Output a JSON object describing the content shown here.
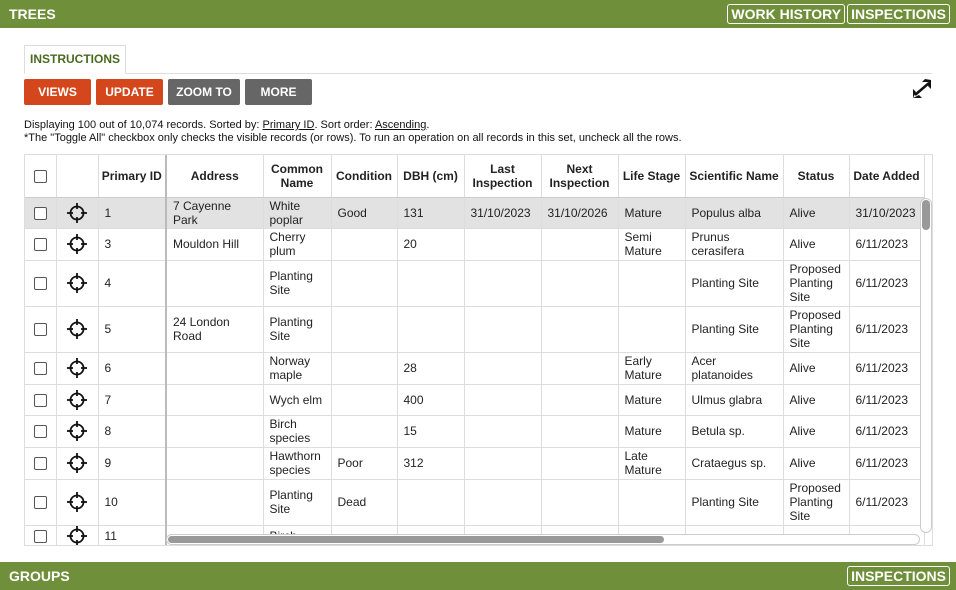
{
  "header": {
    "title": "TREES",
    "buttons": [
      "WORK HISTORY",
      "INSPECTIONS"
    ]
  },
  "tabs": {
    "instructions": "INSTRUCTIONS"
  },
  "actions": {
    "views": "VIEWS",
    "update": "UPDATE",
    "zoom_to": "ZOOM TO",
    "more": "MORE"
  },
  "info": {
    "line1_prefix": "Displaying 100 out of 10,074 records. Sorted by: ",
    "sort_field": "Primary ID",
    "line1_mid": ". Sort order: ",
    "sort_order": "Ascending",
    "line1_suffix": ".",
    "line2": "*The \"Toggle All\" checkbox only checks the visible records (or rows). To run an operation on all records in this set, uncheck all the rows."
  },
  "columns": [
    "Primary ID",
    "Address",
    "Common Name",
    "Condition",
    "DBH (cm)",
    "Last Inspection",
    "Next Inspection",
    "Life Stage",
    "Scientific Name",
    "Status",
    "Date Added"
  ],
  "rows": [
    {
      "id": "1",
      "address": "7 Cayenne Park",
      "common": "White poplar",
      "condition": "Good",
      "dbh": "131",
      "last": "31/10/2023",
      "next": "31/10/2026",
      "life": "Mature",
      "sci": "Populus alba",
      "status": "Alive",
      "added": "31/10/2023",
      "selected": true
    },
    {
      "id": "3",
      "address": "Mouldon Hill",
      "common": "Cherry plum",
      "condition": "",
      "dbh": "20",
      "last": "",
      "next": "",
      "life": "Semi Mature",
      "sci": "Prunus cerasifera",
      "status": "Alive",
      "added": "6/11/2023"
    },
    {
      "id": "4",
      "address": "",
      "common": "Planting Site",
      "condition": "",
      "dbh": "",
      "last": "",
      "next": "",
      "life": "",
      "sci": "Planting Site",
      "status": "Proposed Planting Site",
      "added": "6/11/2023"
    },
    {
      "id": "5",
      "address": "24 London Road",
      "common": "Planting Site",
      "condition": "",
      "dbh": "",
      "last": "",
      "next": "",
      "life": "",
      "sci": "Planting Site",
      "status": "Proposed Planting Site",
      "added": "6/11/2023"
    },
    {
      "id": "6",
      "address": "",
      "common": "Norway maple",
      "condition": "",
      "dbh": "28",
      "last": "",
      "next": "",
      "life": "Early Mature",
      "sci": "Acer platanoides",
      "status": "Alive",
      "added": "6/11/2023"
    },
    {
      "id": "7",
      "address": "",
      "common": "Wych elm",
      "condition": "",
      "dbh": "400",
      "last": "",
      "next": "",
      "life": "Mature",
      "sci": "Ulmus glabra",
      "status": "Alive",
      "added": "6/11/2023"
    },
    {
      "id": "8",
      "address": "",
      "common": "Birch species",
      "condition": "",
      "dbh": "15",
      "last": "",
      "next": "",
      "life": "Mature",
      "sci": "Betula sp.",
      "status": "Alive",
      "added": "6/11/2023"
    },
    {
      "id": "9",
      "address": "",
      "common": "Hawthorn species",
      "condition": "Poor",
      "dbh": "312",
      "last": "",
      "next": "",
      "life": "Late Mature",
      "sci": "Crataegus sp.",
      "status": "Alive",
      "added": "6/11/2023"
    },
    {
      "id": "10",
      "address": "",
      "common": "Planting Site",
      "condition": "Dead",
      "dbh": "",
      "last": "",
      "next": "",
      "life": "",
      "sci": "Planting Site",
      "status": "Proposed Planting Site",
      "added": "6/11/2023"
    },
    {
      "id": "11",
      "address": "",
      "common": "Birch",
      "condition": "",
      "dbh": "",
      "last": "",
      "next": "",
      "life": "",
      "sci": "",
      "status": "",
      "added": ""
    }
  ],
  "footer": {
    "title": "GROUPS",
    "button": "INSPECTIONS"
  },
  "colors": {
    "bar": "#6f8f3a",
    "accent_red": "#d4471c",
    "grey_button": "#666666"
  }
}
